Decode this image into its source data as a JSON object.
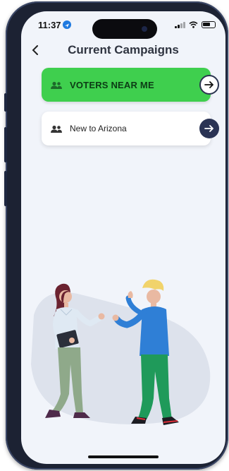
{
  "status_bar": {
    "time": "11:37"
  },
  "header": {
    "title": "Current Campaigns",
    "back_icon": "chevron-left-icon"
  },
  "campaigns": [
    {
      "label": "VOTERS NEAR ME",
      "icon": "people-icon",
      "action_icon": "arrow-right-icon",
      "highlighted": true,
      "color": "#3fcf4e"
    },
    {
      "label": "New to Arizona",
      "icon": "people-icon",
      "action_icon": "arrow-right-icon",
      "highlighted": false,
      "color": "#ffffff"
    }
  ],
  "illustration": {
    "name": "two-people-talking-illustration"
  },
  "colors": {
    "accent_green": "#3fcf4e",
    "navy": "#2a3354",
    "background": "#f1f4fa"
  }
}
